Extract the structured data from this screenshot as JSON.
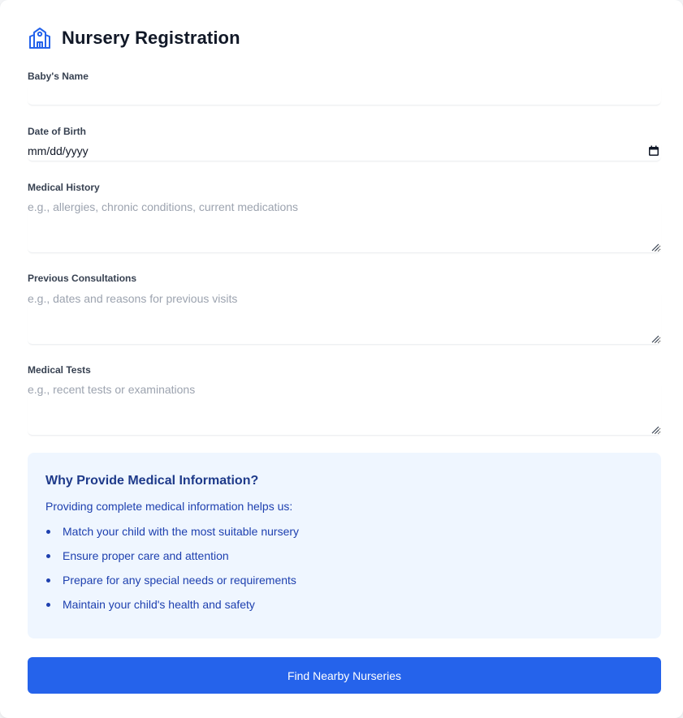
{
  "header": {
    "title": "Nursery Registration",
    "icon": "school-building-icon",
    "icon_color": "#2563eb"
  },
  "form": {
    "baby_name": {
      "label": "Baby's Name",
      "value": "",
      "placeholder": ""
    },
    "dob": {
      "label": "Date of Birth",
      "value": "mm/dd/yyyy",
      "icon": "calendar-icon"
    },
    "medical_history": {
      "label": "Medical History",
      "placeholder": "e.g., allergies, chronic conditions, current medications"
    },
    "previous_consultations": {
      "label": "Previous Consultations",
      "placeholder": "e.g., dates and reasons for previous visits"
    },
    "medical_tests": {
      "label": "Medical Tests",
      "placeholder": "e.g., recent tests or examinations"
    }
  },
  "info": {
    "title": "Why Provide Medical Information?",
    "intro": "Providing complete medical information helps us:",
    "items": [
      "Match your child with the most suitable nursery",
      "Ensure proper care and attention",
      "Prepare for any special needs or requirements",
      "Maintain your child's health and safety"
    ],
    "background": "#eff6ff",
    "text_color": "#1e40af"
  },
  "submit": {
    "label": "Find Nearby Nurseries",
    "color": "#2563eb"
  }
}
